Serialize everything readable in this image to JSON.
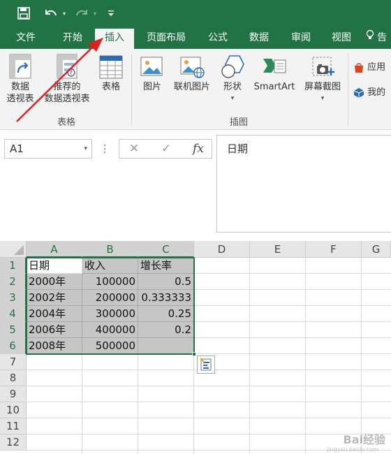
{
  "qat": {
    "save_icon": "save-icon",
    "undo_icon": "undo-icon",
    "redo_icon": "redo-icon",
    "customize_icon": "customize-icon"
  },
  "tabs": [
    {
      "label": "文件"
    },
    {
      "label": "开始"
    },
    {
      "label": "插入"
    },
    {
      "label": "页面布局"
    },
    {
      "label": "公式"
    },
    {
      "label": "数据"
    },
    {
      "label": "审阅"
    },
    {
      "label": "视图"
    },
    {
      "label": "告"
    }
  ],
  "ribbon": {
    "tables": {
      "pivot_line1": "数据",
      "pivot_line2": "透视表",
      "recommended_line1": "推荐的",
      "recommended_line2": "数据透视表",
      "table": "表格",
      "group_label": "表格"
    },
    "illustrations": {
      "picture": "图片",
      "online_picture": "联机图片",
      "shapes": "形状",
      "smartart": "SmartArt",
      "screenshot": "屏幕截图",
      "group_label": "插图"
    },
    "addins": {
      "store": "应用",
      "my": "我的"
    }
  },
  "formula_bar": {
    "name_box": "A1",
    "cancel": "✕",
    "enter": "✓",
    "fx": "fx",
    "content": "日期"
  },
  "columns": [
    "A",
    "B",
    "C",
    "D",
    "E",
    "F",
    "G"
  ],
  "rows": [
    "1",
    "2",
    "3",
    "4",
    "5",
    "6",
    "7",
    "8",
    "9",
    "10",
    "11",
    "12"
  ],
  "cells": {
    "a1": "日期",
    "b1": "收入",
    "c1": "增长率",
    "a2": "2000年",
    "b2": "100000",
    "c2": "0.5",
    "a3": "2002年",
    "b3": "200000",
    "c3": "0.333333",
    "a4": "2004年",
    "b4": "300000",
    "c4": "0.25",
    "a5": "2006年",
    "b5": "400000",
    "c5": "0.2",
    "a6": "2008年",
    "b6": "500000",
    "c6": ""
  },
  "colors": {
    "excel_green": "#217346",
    "annotation_arrow": "#e02020"
  },
  "watermark": {
    "text": "Bai经验",
    "sub": "jingyan.baidu.com"
  }
}
